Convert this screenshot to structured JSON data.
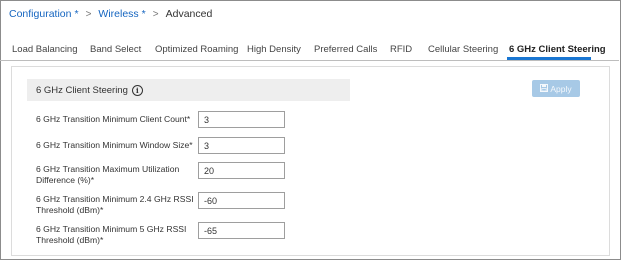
{
  "breadcrumb": {
    "items": [
      "Configuration",
      "Wireless"
    ],
    "required_marker": "*",
    "separator": ">",
    "current": "Advanced"
  },
  "tabs": [
    {
      "label": "Load Balancing"
    },
    {
      "label": "Band Select"
    },
    {
      "label": "Optimized Roaming"
    },
    {
      "label": "High Density"
    },
    {
      "label": "Preferred Calls"
    },
    {
      "label": "RFID"
    },
    {
      "label": "Cellular Steering"
    },
    {
      "label": "6 GHz Client Steering",
      "active": true
    }
  ],
  "section": {
    "title": "6 GHz Client Steering",
    "info_icon_glyph": "i"
  },
  "apply_button": {
    "label": "Apply",
    "icon": "save-icon",
    "state": "disabled"
  },
  "fields": [
    {
      "label_lines": [
        "6 GHz Transition Minimum Client Count*"
      ],
      "value": "3"
    },
    {
      "label_lines": [
        "6 GHz Transition Minimum Window Size*"
      ],
      "value": "3"
    },
    {
      "label_lines": [
        "6 GHz Transition Maximum Utilization",
        "Difference (%)*"
      ],
      "value": "20"
    },
    {
      "label_lines": [
        "6 GHz Transition Minimum 2.4 GHz RSSI",
        "Threshold (dBm)*"
      ],
      "value": "-60"
    },
    {
      "label_lines": [
        "6 GHz Transition Minimum 5 GHz RSSI",
        "Threshold (dBm)*"
      ],
      "value": "-65"
    }
  ],
  "colors": {
    "link": "#1565c0",
    "active_tab_underline": "#1976d2",
    "apply_disabled_bg": "#a7c9e6",
    "section_header_bg": "#eeeeee"
  }
}
